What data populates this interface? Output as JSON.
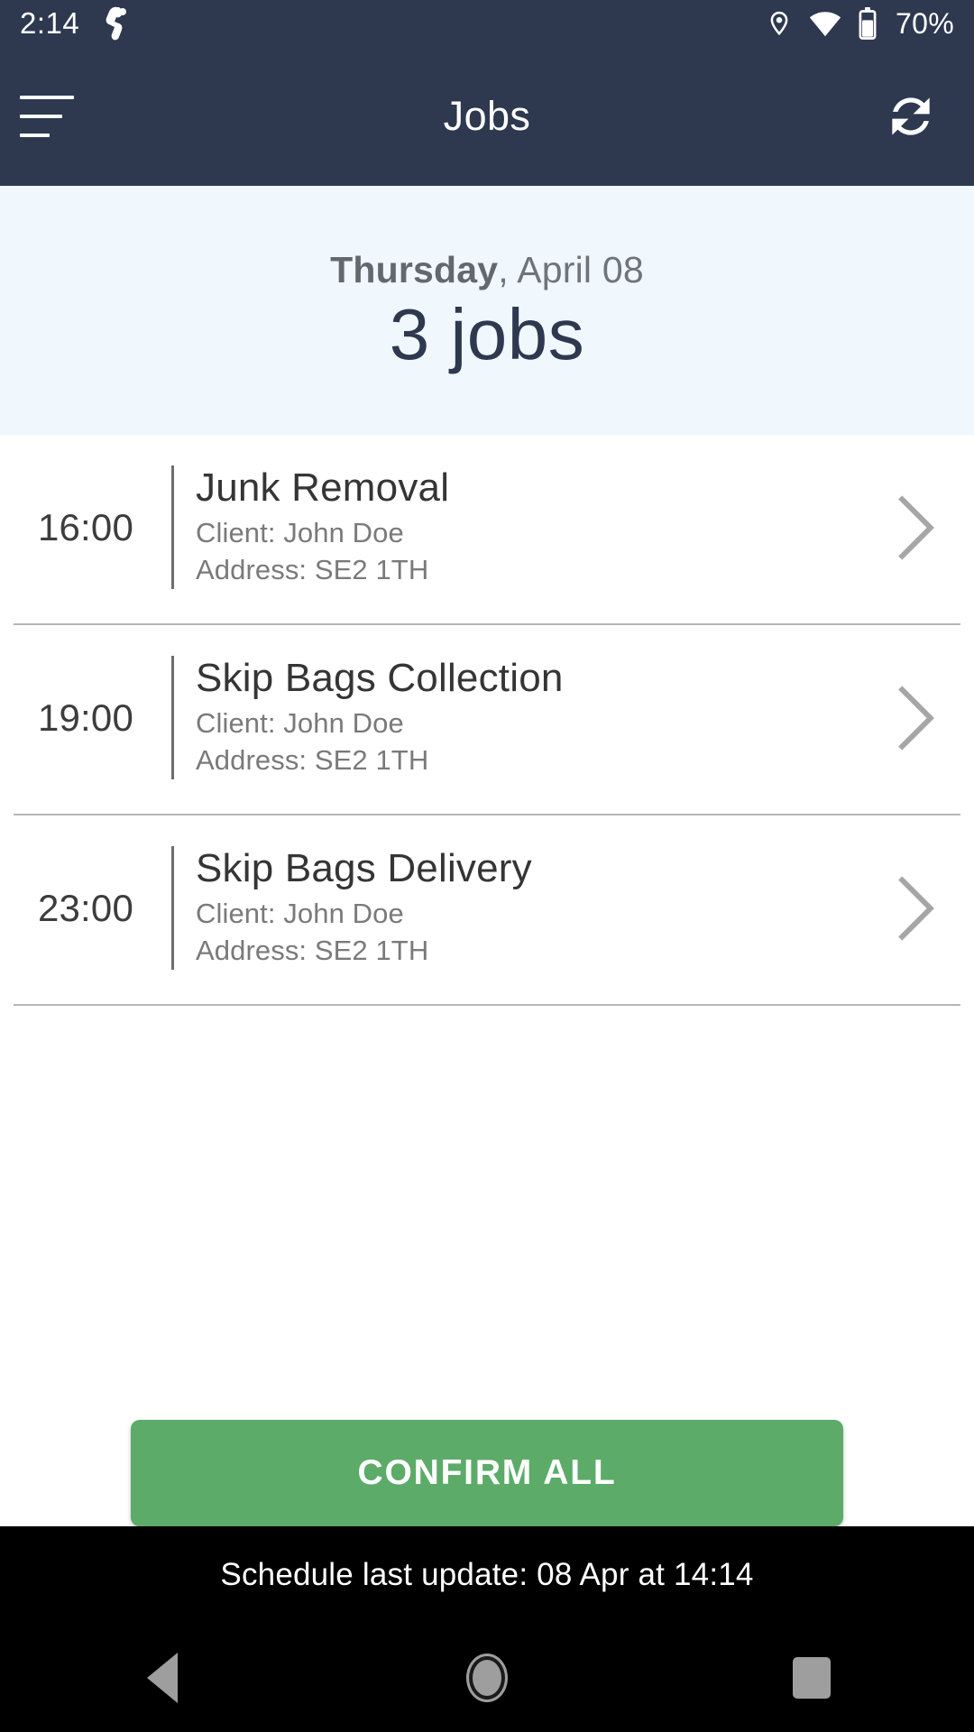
{
  "status_bar": {
    "time": "2:14",
    "app_icon": "android-robot-icon",
    "location_icon": "location-pin-icon",
    "wifi_icon": "wifi-icon",
    "battery_icon": "battery-icon",
    "battery_level": "70%"
  },
  "app_bar": {
    "menu_icon": "hamburger-menu-icon",
    "title": "Jobs",
    "refresh_icon": "refresh-sync-icon"
  },
  "summary": {
    "weekday": "Thursday",
    "date_rest": ", April 08",
    "count_label": "3 jobs"
  },
  "jobs": [
    {
      "time": "16:00",
      "title": "Junk Removal",
      "client": "Client: John Doe",
      "address": "Address: SE2 1TH",
      "chevron_icon": "chevron-right-icon"
    },
    {
      "time": "19:00",
      "title": "Skip Bags Collection",
      "client": "Client: John Doe",
      "address": "Address: SE2 1TH",
      "chevron_icon": "chevron-right-icon"
    },
    {
      "time": "23:00",
      "title": "Skip Bags Delivery",
      "client": "Client: John Doe",
      "address": "Address: SE2 1TH",
      "chevron_icon": "chevron-right-icon"
    }
  ],
  "confirm": {
    "label": "CONFIRM ALL"
  },
  "footer": {
    "text": "Schedule last update: 08 Apr at 14:14"
  },
  "nav_bar": {
    "back_icon": "back-triangle-icon",
    "home_icon": "home-circle-icon",
    "recents_icon": "recents-square-icon"
  },
  "colors": {
    "header": "#2e3950",
    "summary_bg": "#f0f7fd",
    "accent_green": "#5cab69",
    "footer_bg": "#000000"
  }
}
